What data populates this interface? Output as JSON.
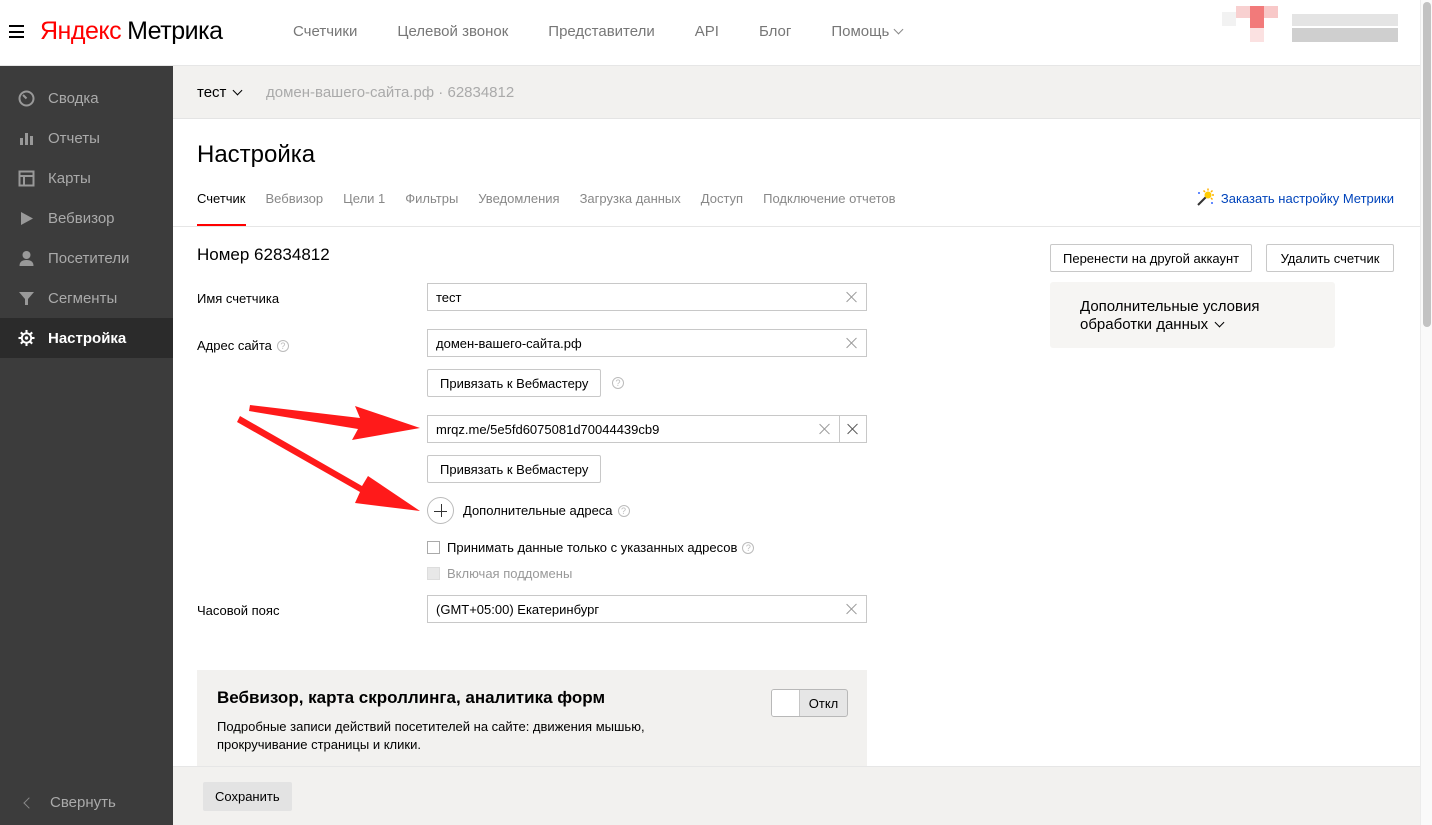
{
  "header": {
    "logo_brand": "Яндекс",
    "logo_product": "Метрика",
    "nav": [
      "Счетчики",
      "Целевой звонок",
      "Представители",
      "API",
      "Блог"
    ],
    "help": "Помощь"
  },
  "sidebar": {
    "items": [
      {
        "label": "Сводка",
        "icon": "gauge-icon"
      },
      {
        "label": "Отчеты",
        "icon": "bar-chart-icon"
      },
      {
        "label": "Карты",
        "icon": "map-icon"
      },
      {
        "label": "Вебвизор",
        "icon": "play-icon"
      },
      {
        "label": "Посетители",
        "icon": "user-icon"
      },
      {
        "label": "Сегменты",
        "icon": "filter-icon"
      },
      {
        "label": "Настройка",
        "icon": "gear-icon"
      }
    ],
    "collapse": "Свернуть"
  },
  "counterbar": {
    "name": "тест",
    "sub": "домен-вашего-сайта.рф · 62834812"
  },
  "page": {
    "title": "Настройка",
    "tabs": [
      "Счетчик",
      "Вебвизор",
      "Цели 1",
      "Фильтры",
      "Уведомления",
      "Загрузка данных",
      "Доступ",
      "Подключение отчетов"
    ],
    "order_link": "Заказать настройку Метрики"
  },
  "form": {
    "section_title": "Номер 62834812",
    "name_label": "Имя счетчика",
    "name_value": "тест",
    "site_label": "Адрес сайта",
    "site_value": "домен-вашего-сайта.рф",
    "bind_webmaster": "Привязать к Вебмастеру",
    "extra_site_value": "mrqz.me/5e5fd6075081d70044439cb9",
    "bind_webmaster_2": "Привязать к Вебмастеру",
    "add_addresses": "Дополнительные адреса",
    "accept_only": "Принимать данные только с указанных адресов",
    "include_subdomains": "Включая поддомены",
    "timezone_label": "Часовой пояс",
    "timezone_value": "(GMT+05:00) Екатеринбург"
  },
  "actions": {
    "transfer": "Перенести на другой аккаунт",
    "delete": "Удалить счетчик"
  },
  "extra_panel": {
    "line1": "Дополнительные условия",
    "line2": "обработки данных"
  },
  "webvisor": {
    "title": "Вебвизор, карта скроллинга, аналитика форм",
    "desc": "Подробные записи действий посетителей на сайте: движения мышью, прокручивание страницы и клики.",
    "toggle_label": "Откл"
  },
  "footer": {
    "save": "Сохранить"
  },
  "colors": {
    "brand_red": "#ff0000",
    "sidebar_bg": "#3c3c3c",
    "link_blue": "#0044bb",
    "arrow_red": "#ff1a1a"
  }
}
